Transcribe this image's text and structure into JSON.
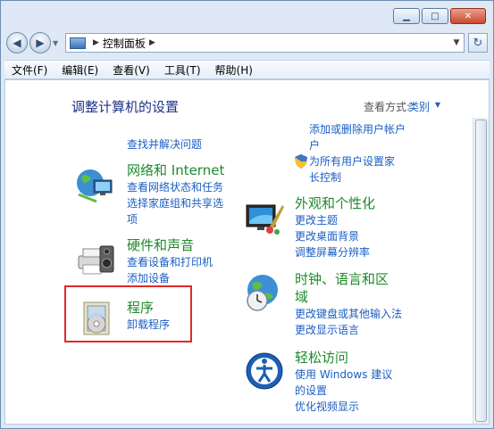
{
  "window": {
    "address": {
      "crumb": "控制面板"
    }
  },
  "menu": [
    "文件(F)",
    "编辑(E)",
    "查看(V)",
    "工具(T)",
    "帮助(H)"
  ],
  "page": {
    "title": "调整计算机的设置",
    "view_by_label": "查看方式:",
    "view_by_value": "类别"
  },
  "left": {
    "partial_link": "查找并解决问题",
    "network": {
      "title": "网络和 Internet",
      "links": [
        "查看网络状态和任务",
        "选择家庭组和共享选",
        "项"
      ]
    },
    "hardware": {
      "title": "硬件和声音",
      "links": [
        "查看设备和打印机",
        "添加设备"
      ]
    },
    "programs": {
      "title": "程序",
      "links": [
        "卸载程序"
      ]
    }
  },
  "right": {
    "partial_top": [
      "添加或删除用户帐户",
      "户",
      "为所有用户设置家",
      "长控制"
    ],
    "appearance": {
      "title": "外观和个性化",
      "links": [
        "更改主题",
        "更改桌面背景",
        "调整屏幕分辨率"
      ]
    },
    "clock": {
      "title_line1": "时钟、语言和区",
      "title_line2": "域",
      "links": [
        "更改键盘或其他输入法",
        "更改显示语言"
      ]
    },
    "ease": {
      "title": "轻松访问",
      "links": [
        "使用 Windows 建议",
        "的设置",
        "优化视频显示"
      ]
    }
  },
  "colors": {
    "category_title": "#1d8a2a",
    "link": "#1a5ec4",
    "highlight": "#e0282a"
  }
}
